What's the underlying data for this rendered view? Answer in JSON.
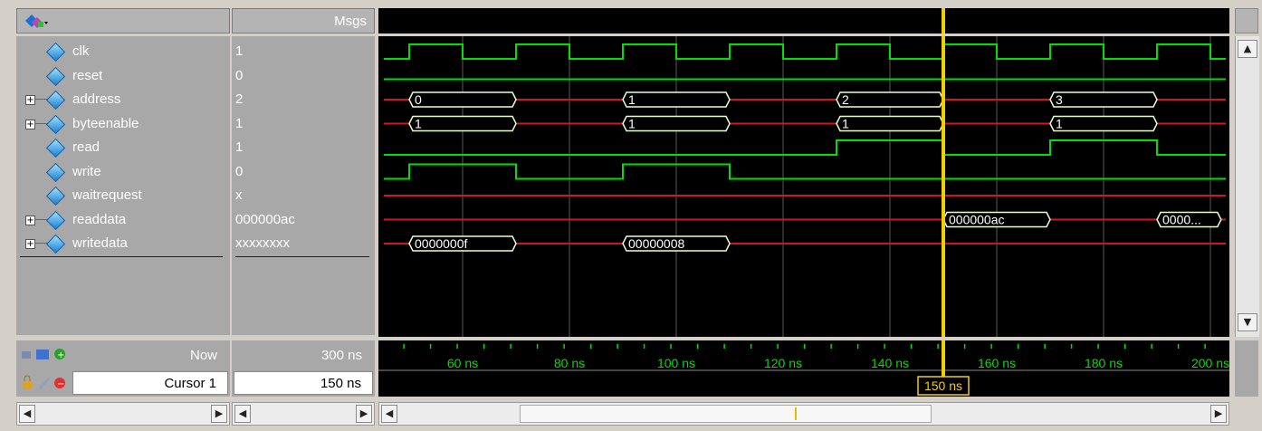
{
  "toolbar": {
    "icon": "wave-tool-icon"
  },
  "headers": {
    "msgs": "Msgs"
  },
  "signals": [
    {
      "name": "clk",
      "value": "1",
      "expandable": false
    },
    {
      "name": "reset",
      "value": "0",
      "expandable": false
    },
    {
      "name": "address",
      "value": "2",
      "expandable": true
    },
    {
      "name": "byteenable",
      "value": "1",
      "expandable": true
    },
    {
      "name": "read",
      "value": "1",
      "expandable": false
    },
    {
      "name": "write",
      "value": "0",
      "expandable": false
    },
    {
      "name": "waitrequest",
      "value": "x",
      "expandable": false
    },
    {
      "name": "readdata",
      "value": "000000ac",
      "expandable": true
    },
    {
      "name": "writedata",
      "value": "xxxxxxxx",
      "expandable": true
    }
  ],
  "waves": {
    "time_range_ns": [
      44,
      200
    ],
    "clk_period_ns": 20,
    "clk_first_rise_ns": 50,
    "address_buses": [
      {
        "start": 50,
        "end": 70,
        "label": "0"
      },
      {
        "start": 90,
        "end": 110,
        "label": "1"
      },
      {
        "start": 130,
        "end": 150,
        "label": "2"
      },
      {
        "start": 170,
        "end": 190,
        "label": "3"
      }
    ],
    "byteenable_buses": [
      {
        "start": 50,
        "end": 70,
        "label": "1"
      },
      {
        "start": 90,
        "end": 110,
        "label": "1"
      },
      {
        "start": 130,
        "end": 150,
        "label": "1"
      },
      {
        "start": 170,
        "end": 190,
        "label": "1"
      }
    ],
    "read_high": [
      [
        130,
        150
      ],
      [
        170,
        190
      ]
    ],
    "write_high": [
      [
        50,
        70
      ],
      [
        90,
        110
      ]
    ],
    "readdata_buses": [
      {
        "start": 150,
        "end": 170,
        "label": "000000ac"
      },
      {
        "start": 190,
        "end": 202,
        "label": "0000..."
      }
    ],
    "writedata_buses": [
      {
        "start": 50,
        "end": 70,
        "label": "0000000f"
      },
      {
        "start": 90,
        "end": 110,
        "label": "00000008"
      }
    ],
    "colors": {
      "green": "#00e000",
      "red": "#d01818",
      "cursor": "#f0d000",
      "grid": "#5a5a5a"
    }
  },
  "footer": {
    "now_label": "Now",
    "now_value": "300 ns",
    "cursor_label": "Cursor 1",
    "cursor_value": "150 ns",
    "cursor_ns": 150,
    "cursor_flag": "150 ns",
    "ticks": [
      "60 ns",
      "80 ns",
      "100 ns",
      "120 ns",
      "140 ns",
      "160 ns",
      "180 ns",
      "200 ns"
    ],
    "tick_values_ns": [
      60,
      80,
      100,
      120,
      140,
      160,
      180,
      200
    ]
  }
}
